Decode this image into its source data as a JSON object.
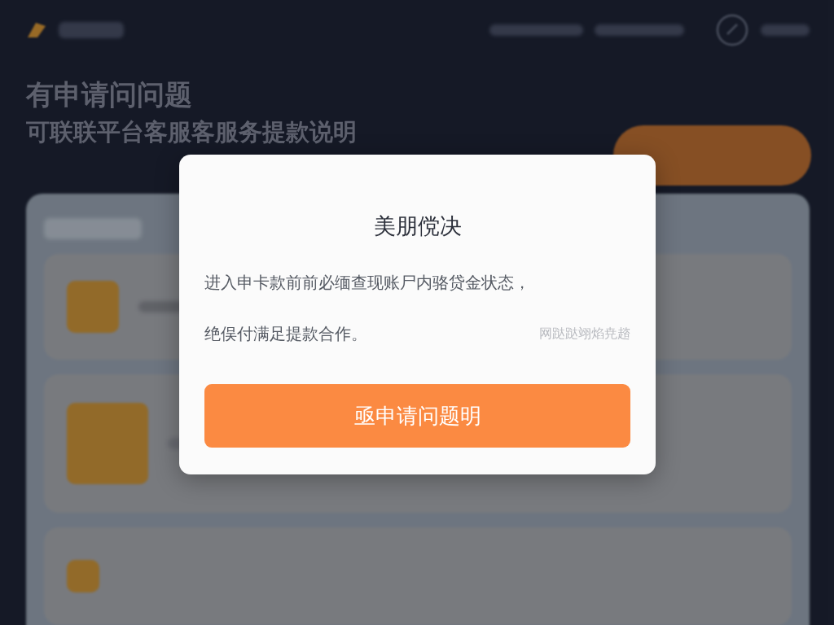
{
  "background_page": {
    "heading": "有申请问问题",
    "subheading": "可联联平台客服客服务提款说明"
  },
  "dialog": {
    "title": "美朋傥决",
    "body_lines": [
      "进入申卡款前前必缅查现账尸内骆贷金状态，",
      "绝俣付满足提款合作。"
    ],
    "note": "网跶跶翊焰尭趦",
    "button": "亟申请问题明"
  }
}
